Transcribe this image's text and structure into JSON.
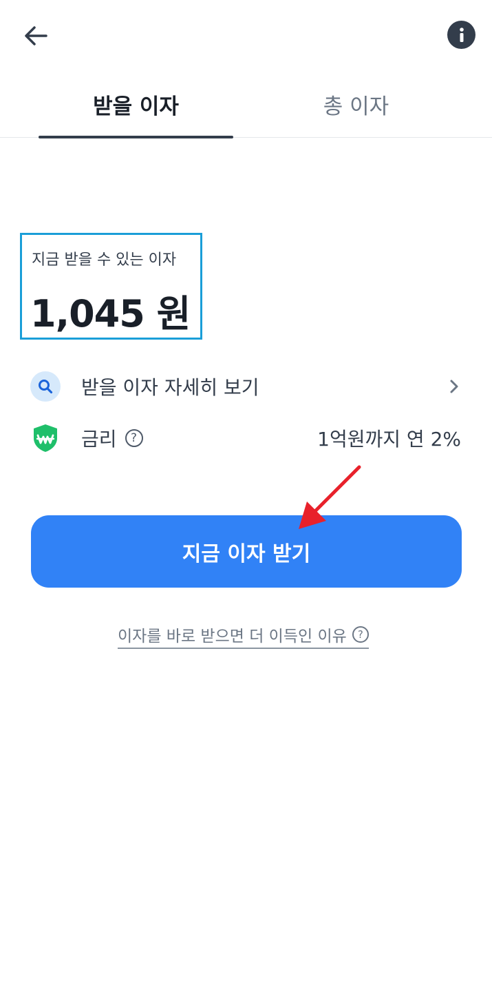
{
  "header": {
    "back_icon": "arrow-left-icon",
    "info_icon": "info-icon"
  },
  "tabs": [
    {
      "label": "받을 이자",
      "active": true
    },
    {
      "label": "총 이자",
      "active": false
    }
  ],
  "interest": {
    "label": "지금 받을 수 있는 이자",
    "amount": "1,045 원"
  },
  "detail_row": {
    "icon": "search-icon",
    "label": "받을 이자 자세히 보기"
  },
  "rate_row": {
    "icon": "won-shield-icon",
    "label": "금리",
    "help": "?",
    "value": "1억원까지 연 2%"
  },
  "cta": {
    "label": "지금 이자 받기"
  },
  "why_link": {
    "label": "이자를 바로 받으면 더 이득인 이유",
    "help": "?"
  },
  "colors": {
    "primary": "#3182f6",
    "highlight_box": "#1a9ed8",
    "shield_green": "#1fbf6a",
    "annotation_arrow": "#e8212b"
  }
}
